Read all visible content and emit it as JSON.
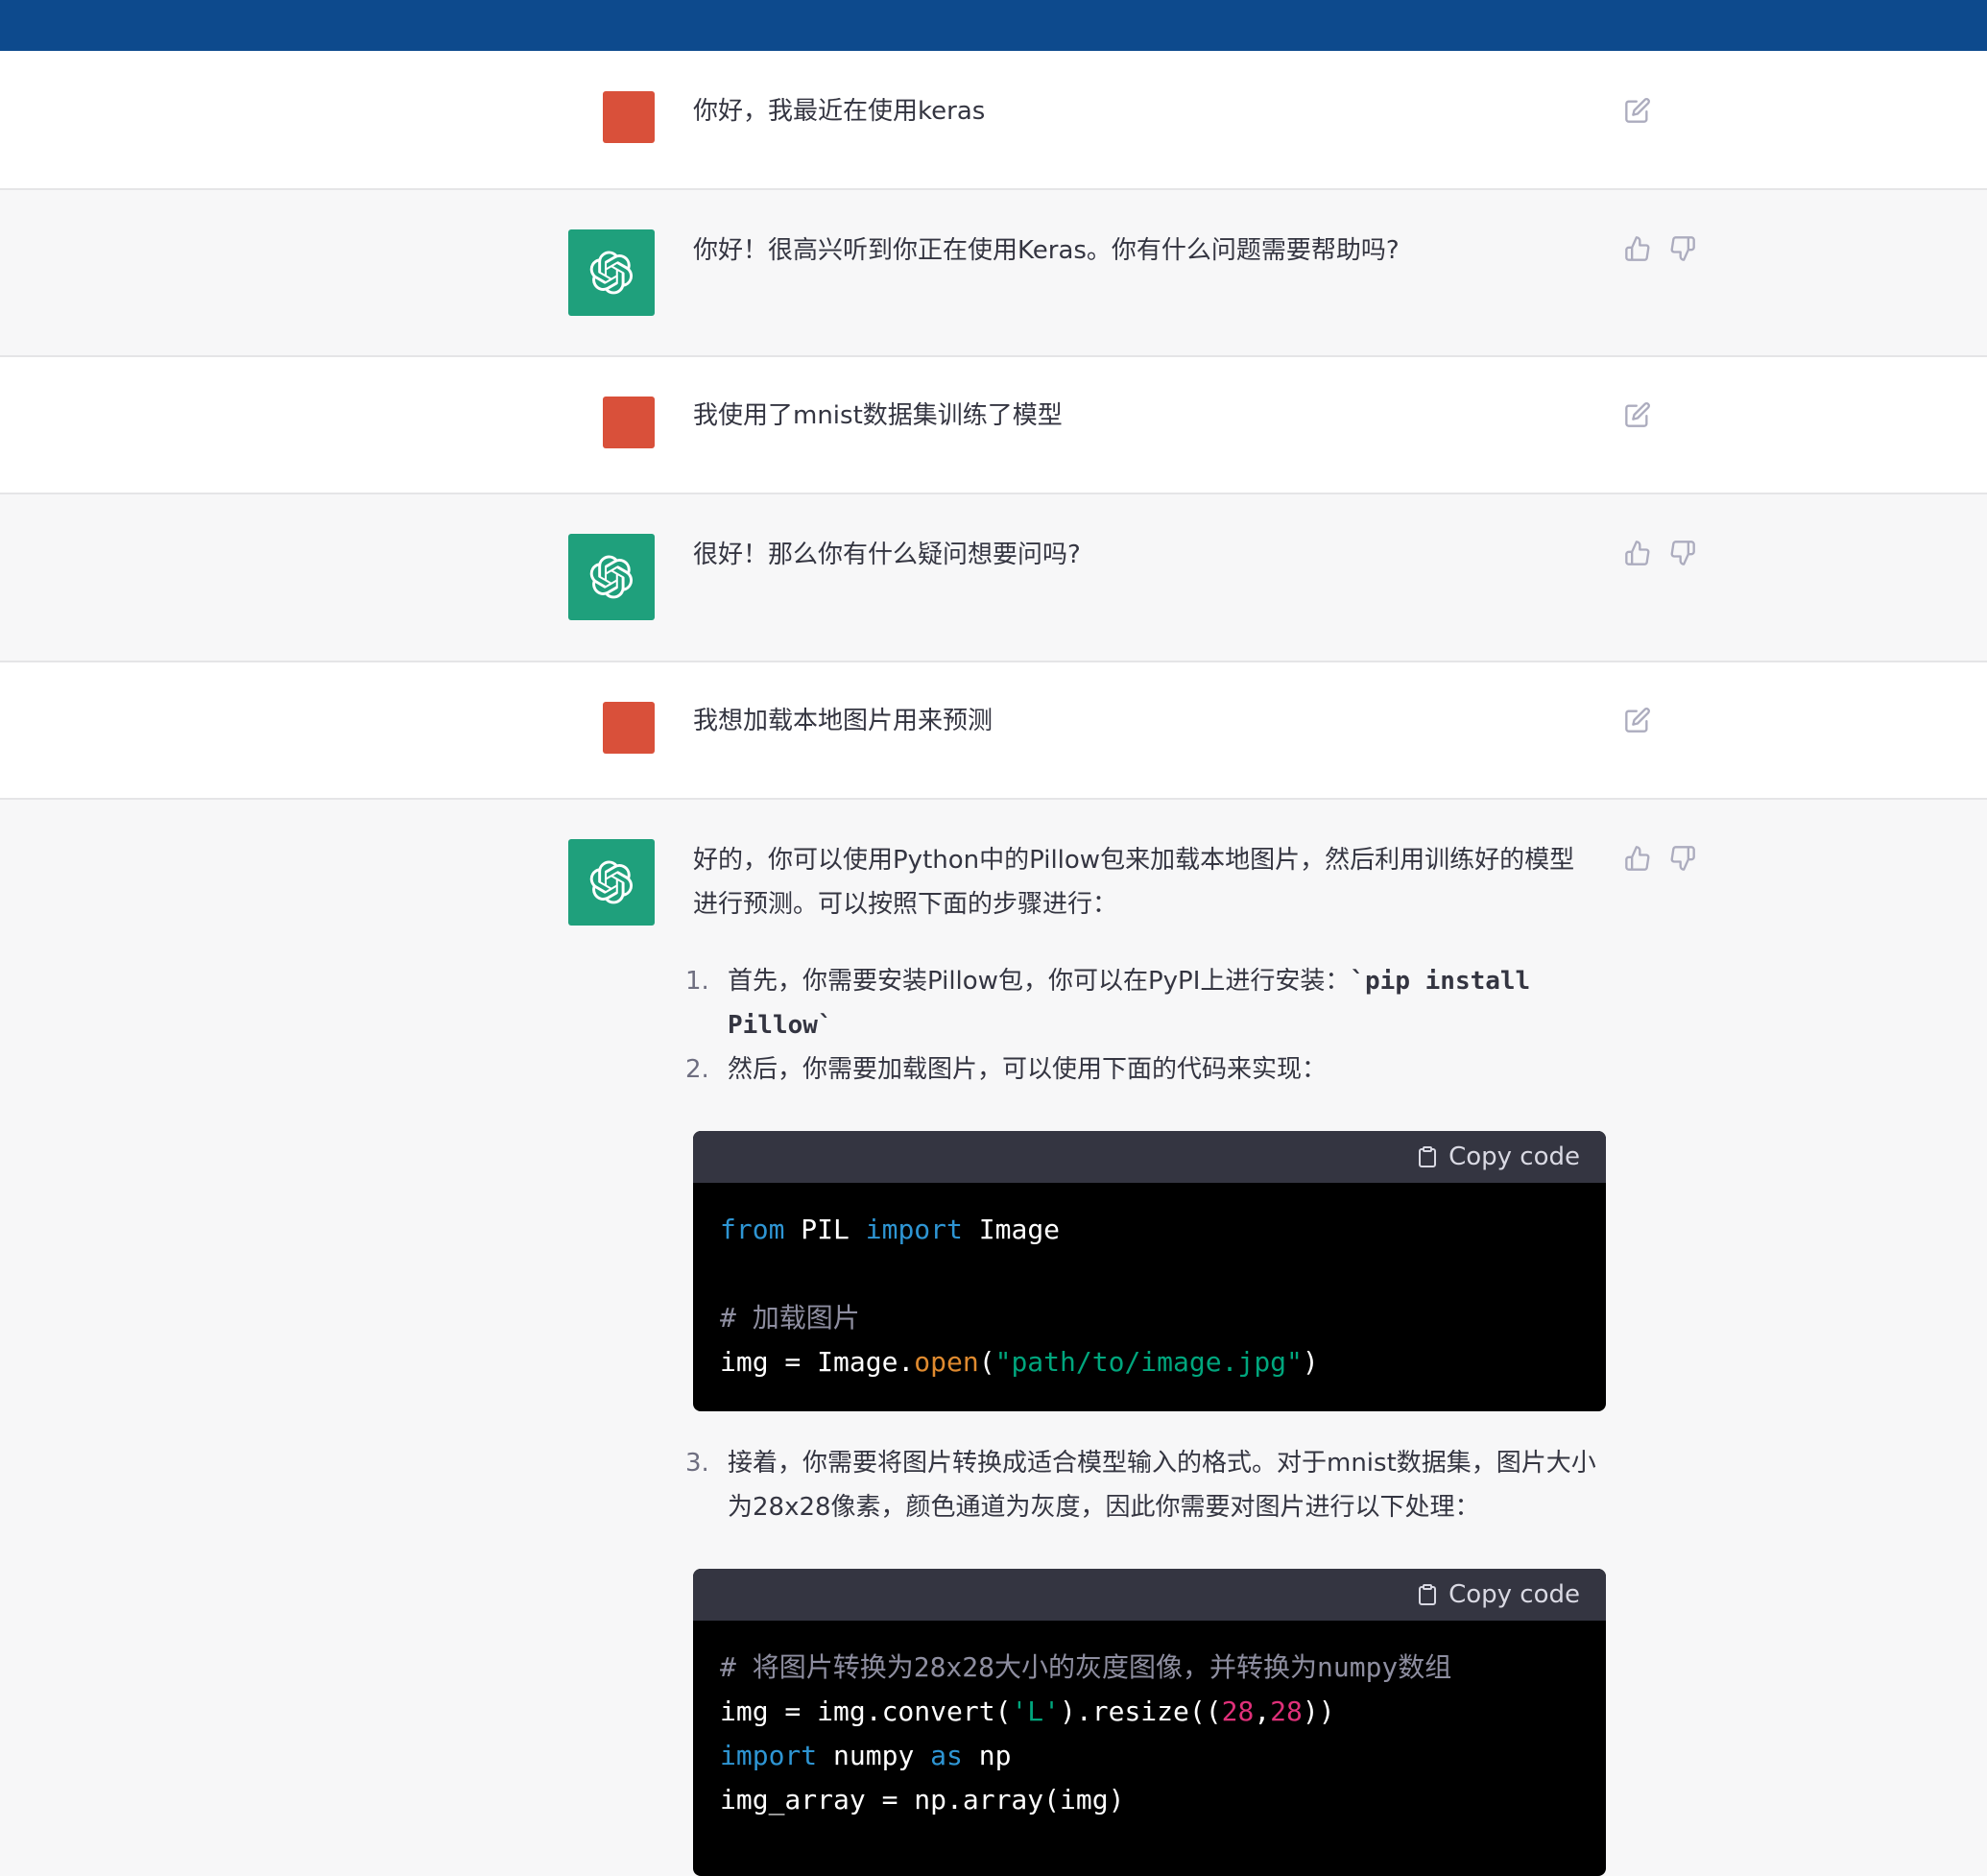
{
  "messages": [
    {
      "role": "user",
      "text": "你好，我最近在使用keras"
    },
    {
      "role": "assistant",
      "text": "你好！很高兴听到你正在使用Keras。你有什么问题需要帮助吗?"
    },
    {
      "role": "user",
      "text": "我使用了mnist数据集训练了模型"
    },
    {
      "role": "assistant",
      "text": "很好！那么你有什么疑问想要问吗?"
    },
    {
      "role": "user",
      "text": "我想加载本地图片用来预测"
    },
    {
      "role": "assistant",
      "intro": "好的，你可以使用Python中的Pillow包来加载本地图片，然后利用训练好的模型进行预测。可以按照下面的步骤进行：",
      "steps": [
        {
          "num": "1.",
          "text": "首先，你需要安装Pillow包，你可以在PyPI上进行安装：",
          "code": "`pip install Pillow`"
        },
        {
          "num": "2.",
          "text": "然后，你需要加载图片，可以使用下面的代码来实现："
        },
        {
          "num": "3.",
          "text": "接着，你需要将图片转换成适合模型输入的格式。对于mnist数据集，图片大小为28x28像素，颜色通道为灰度，因此你需要对图片进行以下处理："
        }
      ],
      "code_blocks": [
        {
          "copy_label": "Copy code",
          "lines": [
            "from PIL import Image",
            "",
            "# 加载图片",
            "img = Image.open(\"path/to/image.jpg\")"
          ]
        },
        {
          "copy_label": "Copy code",
          "lines": [
            "# 将图片转换为28x28大小的灰度图像，并转换为numpy数组",
            "img = img.convert('L').resize((28,28))",
            "import numpy as np",
            "img_array = np.array(img)"
          ]
        }
      ]
    }
  ],
  "colors": {
    "topbar": "#0d4a8d",
    "user_avatar": "#d9503a",
    "assistant_avatar": "#1fa07c"
  }
}
